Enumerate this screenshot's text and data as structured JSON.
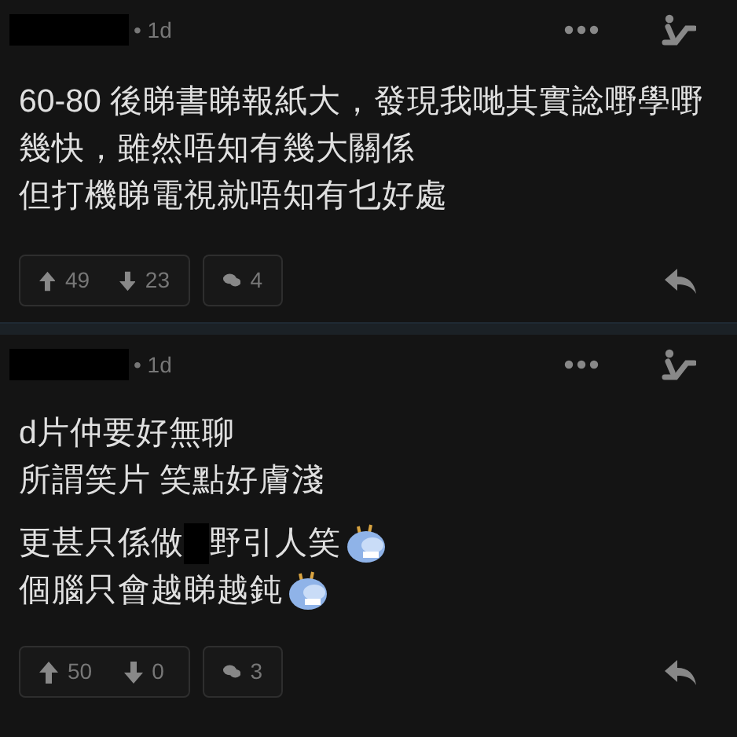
{
  "posts": [
    {
      "time": "• 1d",
      "paragraphs": [
        [
          {
            "parts": [
              {
                "kind": "text",
                "text": "60-80 後睇書睇報紙大，發現我哋其實諗嘢學嘢"
              }
            ]
          },
          {
            "parts": [
              {
                "kind": "text",
                "text": "幾快，雖然唔知有幾大關係"
              }
            ]
          },
          {
            "parts": [
              {
                "kind": "text",
                "text": "但打機睇電視就唔知有乜好處"
              }
            ]
          }
        ]
      ],
      "upvotes": "49",
      "downvotes": "23",
      "comments": "4"
    },
    {
      "time": "• 1d",
      "paragraphs": [
        [
          {
            "parts": [
              {
                "kind": "text",
                "text": "d片仲要好無聊"
              }
            ]
          },
          {
            "parts": [
              {
                "kind": "text",
                "text": "所謂笑片 笑點好膚淺"
              }
            ]
          }
        ],
        [
          {
            "parts": [
              {
                "kind": "text",
                "text": "更甚只係做"
              },
              {
                "kind": "redacted"
              },
              {
                "kind": "text",
                "text": "野引人笑"
              },
              {
                "kind": "sticker"
              }
            ]
          },
          {
            "parts": [
              {
                "kind": "text",
                "text": "個腦只會越睇越鈍"
              },
              {
                "kind": "sticker"
              }
            ]
          }
        ]
      ],
      "upvotes": "50",
      "downvotes": "0",
      "comments": "3"
    }
  ]
}
